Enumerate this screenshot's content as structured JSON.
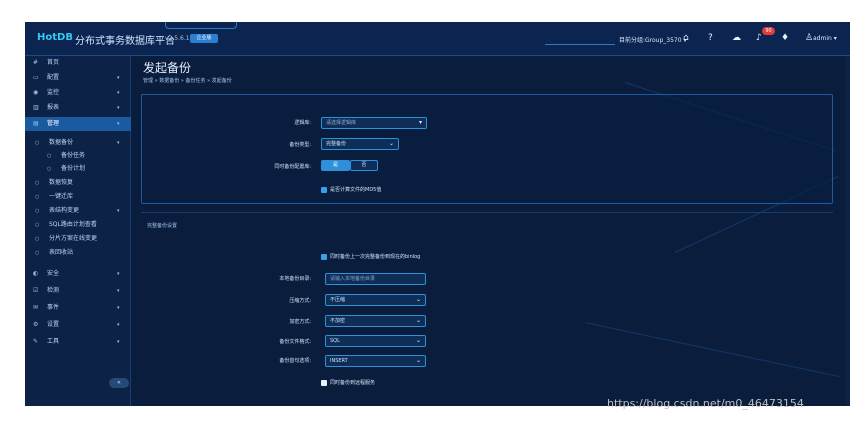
{
  "header": {
    "logo": "HotDB",
    "title": "分布式事务数据库平台",
    "version": "v2.5.6.1",
    "version_badge": "企业版",
    "user_group": "目前分组:Group_3570 ▾",
    "notification_count": "90",
    "user": "admin ▾",
    "icons": [
      "home-icon",
      "help-icon",
      "cloud-icon",
      "bell-icon",
      "shirt-icon",
      "user-icon"
    ]
  },
  "sidebar": {
    "items": [
      {
        "icon": "#",
        "label": "首页",
        "chev": ""
      },
      {
        "icon": "▭",
        "label": "配置",
        "chev": "▾"
      },
      {
        "icon": "◉",
        "label": "监控",
        "chev": "▾"
      },
      {
        "icon": "▥",
        "label": "报表",
        "chev": "▾"
      },
      {
        "icon": "▤",
        "label": "管理",
        "chev": "▾"
      },
      {
        "icon": "○",
        "label": "数据备份",
        "chev": "▾"
      },
      {
        "icon": "○",
        "label": "备份任务",
        "chev": ""
      },
      {
        "icon": "○",
        "label": "备份计划",
        "chev": ""
      },
      {
        "icon": "○",
        "label": "数据恢复",
        "chev": ""
      },
      {
        "icon": "○",
        "label": "一键迁库",
        "chev": ""
      },
      {
        "icon": "○",
        "label": "表结构变更",
        "chev": "▾"
      },
      {
        "icon": "○",
        "label": "SQL路由计划查看",
        "chev": ""
      },
      {
        "icon": "○",
        "label": "分片方案在线变更",
        "chev": ""
      },
      {
        "icon": "○",
        "label": "表回收站",
        "chev": ""
      },
      {
        "icon": "◐",
        "label": "安全",
        "chev": "▾"
      },
      {
        "icon": "☑",
        "label": "检测",
        "chev": "▾"
      },
      {
        "icon": "✉",
        "label": "事件",
        "chev": "▾"
      },
      {
        "icon": "⚙",
        "label": "设置",
        "chev": "▾"
      },
      {
        "icon": "✎",
        "label": "工具",
        "chev": "▾"
      }
    ],
    "collapse_label": "«"
  },
  "main": {
    "title": "发起备份",
    "breadcrumb": "管理 » 数据备份 » 备份任务 » 发起备份",
    "form1": {
      "logic_db_label": "逻辑库:",
      "logic_db_placeholder": "请选择逻辑库",
      "backup_type_label": "备份类型:",
      "backup_type_value": "完整备份",
      "backup_config_label": "同时备份配置库:",
      "toggle_yes": "是",
      "toggle_no": "否",
      "md5_label": "是否计算文件的MD5值"
    },
    "section2_title": "完整备份设置",
    "form2": {
      "binlog_label": "同时备份上一次完整备份到现在的binlog",
      "local_dir_label": "本地备份目录:",
      "local_dir_placeholder": "请输入本地备份目录",
      "compress_label": "压缩方式:",
      "compress_value": "不压缩",
      "encrypt_label": "加密方式:",
      "encrypt_value": "不加密",
      "file_format_label": "备份文件格式:",
      "file_format_value": "SQL",
      "statement_label": "备份首句选项:",
      "statement_value": "INSERT",
      "remote_label": "同时备份到远程服务"
    }
  },
  "watermark": "https://blog.csdn.net/m0_46473154"
}
